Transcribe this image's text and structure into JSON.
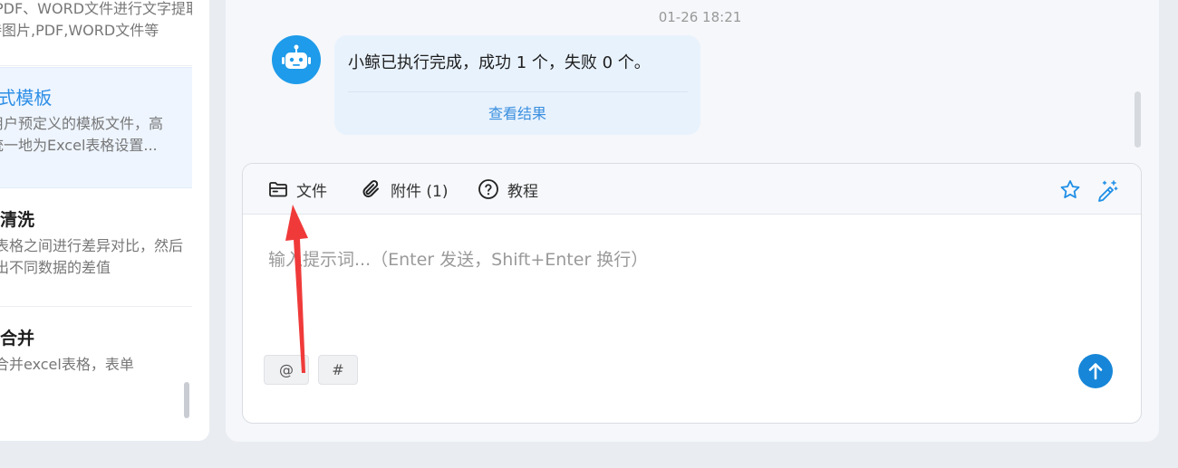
{
  "left_panel": {
    "items": [
      {
        "title": "",
        "desc": [
          "支持图片、PDF、WORD文件进行文字提取，支",
          "持图片,PDF,WORD文件等"
        ]
      },
      {
        "title": "Excel 格式模板",
        "desc": [
          "通过用户预定义的模板文件，高",
          "效、统一地为Excel表格设置..."
        ]
      },
      {
        "title": "数据清洗",
        "desc": [
          "两个表格之间进行差异对比，然后",
          "标记出不同数据的差值"
        ]
      },
      {
        "title": "表格合并",
        "desc": [
          "批量合并excel表格，表单"
        ]
      }
    ]
  },
  "chat": {
    "timestamp": "01-26 18:21",
    "bot_message": "小鲸已执行完成，成功 1 个，失败 0 个。",
    "view_result_link": "查看结果"
  },
  "toolbar": {
    "file_label": "文件",
    "attachment_label": "附件 (1)",
    "tutorial_label": "教程"
  },
  "input": {
    "placeholder": "输入提示词...（Enter 发送，Shift+Enter 换行）",
    "value": ""
  },
  "chips": {
    "mention": "@",
    "hashtag": "#"
  },
  "colors": {
    "accent": "#1786d8",
    "annotation": "#f03a3a"
  }
}
